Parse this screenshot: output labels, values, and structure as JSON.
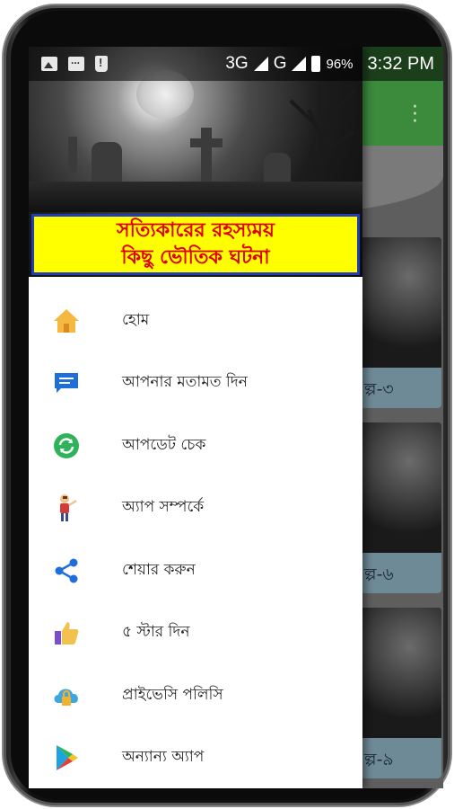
{
  "status_bar": {
    "network_1": "3G",
    "network_2": "G",
    "battery": "96%",
    "time": "3:32 PM"
  },
  "drawer": {
    "title_line1": "সত্যিকারের রহস্যময়",
    "title_line2": "কিছু ভৌতিক ঘটনা",
    "menu": [
      {
        "label": "হোম",
        "icon": "home-icon"
      },
      {
        "label": "আপনার মতামত দিন",
        "icon": "feedback-icon"
      },
      {
        "label": "আপডেট চেক",
        "icon": "update-icon"
      },
      {
        "label": "অ্যাপ সম্পর্কে",
        "icon": "about-icon"
      },
      {
        "label": "শেয়ার করুন",
        "icon": "share-icon"
      },
      {
        "label": "৫ স্টার দিন",
        "icon": "thumbs-up-icon"
      },
      {
        "label": "প্রাইভেসি পলিসি",
        "icon": "privacy-icon"
      },
      {
        "label": "অন্যান্য অ্যাপ",
        "icon": "play-store-icon"
      }
    ]
  },
  "background_list": {
    "cards": [
      "ল্প-৩",
      "ল্প-৬",
      "ল্প-৯"
    ]
  },
  "colors": {
    "toolbar": "#3c8a3c",
    "banner_bg": "#ffff00",
    "banner_text": "#e00000",
    "banner_border": "#1f3fb3"
  }
}
